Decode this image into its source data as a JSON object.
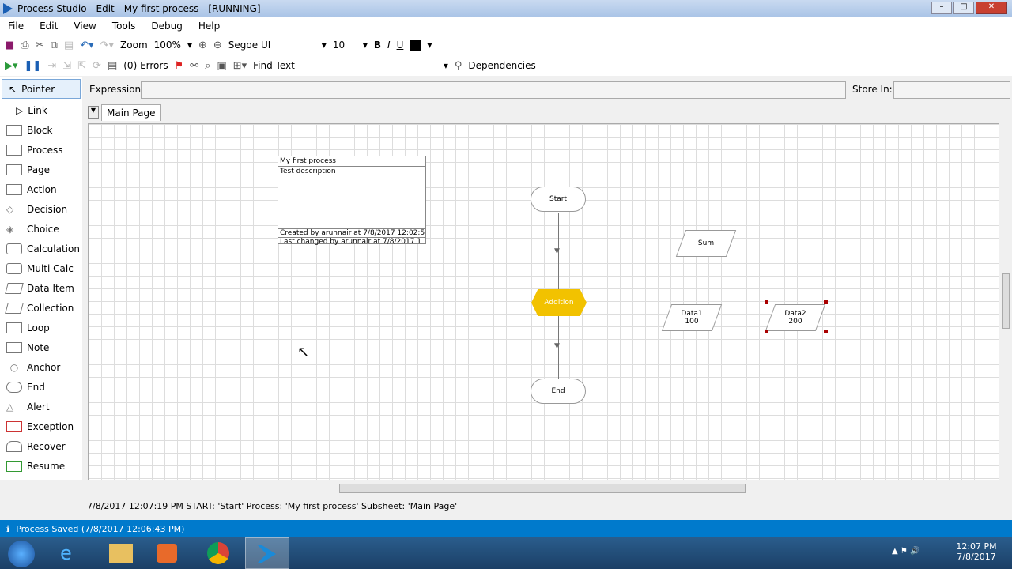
{
  "window": {
    "title": "Process Studio  - Edit - My first process - [RUNNING]"
  },
  "menu": [
    "File",
    "Edit",
    "View",
    "Tools",
    "Debug",
    "Help"
  ],
  "toolbar": {
    "zoom_label": "Zoom",
    "zoom_value": "100%",
    "font": "Segoe UI",
    "font_size": "10",
    "bold": "B",
    "italic": "I",
    "underline": "U",
    "errors": "(0) Errors",
    "find_text": "Find Text",
    "dependencies": "Dependencies"
  },
  "expression": {
    "label": "Expression:",
    "value": "",
    "store_in": "Store In:"
  },
  "tabs": [
    "Main Page"
  ],
  "palette": [
    "Pointer",
    "Link",
    "Block",
    "Process",
    "Page",
    "Action",
    "Decision",
    "Choice",
    "Calculation",
    "Multi Calc",
    "Data Item",
    "Collection",
    "Loop",
    "Note",
    "Anchor",
    "End",
    "Alert",
    "Exception",
    "Recover",
    "Resume"
  ],
  "info_box": {
    "title": "My first process",
    "description": "Test description",
    "created": "Created by arunnair at 7/8/2017 12:02:5",
    "changed": "Last changed by arunnair at 7/8/2017 1"
  },
  "nodes": {
    "start": "Start",
    "addition": "Addition",
    "end": "End",
    "sum": "Sum",
    "data1": "Data1",
    "data1_value": "100",
    "data2": "Data2",
    "data2_value": "200"
  },
  "log": "7/8/2017 12:07:19 PM START: 'Start' Process: 'My first process' Subsheet: 'Main Page'",
  "status": "Process Saved (7/8/2017 12:06:43 PM)",
  "clock": {
    "time": "12:07 PM",
    "date": "7/8/2017"
  },
  "colors": {
    "accent": "#007acc",
    "decision": "#f2c200"
  }
}
